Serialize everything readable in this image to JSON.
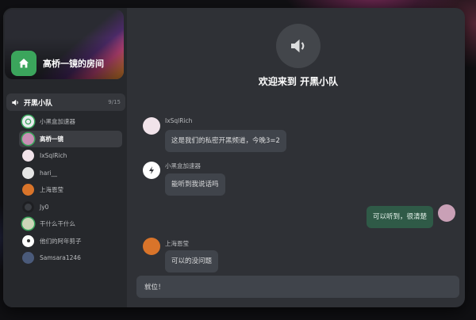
{
  "sidebar": {
    "room_name": "高桥一镜的房间",
    "channel": {
      "name": "开黑小队",
      "count": "9/15"
    },
    "members": [
      {
        "name": "小黑盒加速器",
        "avatar_color": "#e9ecef",
        "avatar_text": "◎"
      },
      {
        "name": "高桥一镜",
        "avatar_color": "#c98fb5",
        "avatar_text": ""
      },
      {
        "name": "IxSqlRich",
        "avatar_color": "#f1e3ea",
        "avatar_text": ""
      },
      {
        "name": "hari__",
        "avatar_color": "#e5e5e5",
        "avatar_text": ""
      },
      {
        "name": "上海恩莹",
        "avatar_color": "#d9742a",
        "avatar_text": ""
      },
      {
        "name": "Jy0",
        "avatar_color": "#3a3d42",
        "avatar_text": ""
      },
      {
        "name": "干什么干什么",
        "avatar_color": "#ccd6b8",
        "avatar_text": ""
      },
      {
        "name": "他们的阿年剪子",
        "avatar_color": "#ffffff",
        "avatar_text": ""
      },
      {
        "name": "Samsara1246",
        "avatar_color": "#4a5a7a",
        "avatar_text": ""
      }
    ]
  },
  "main": {
    "welcome": "欢迎来到 开黑小队",
    "messages": [
      {
        "author": "IxSqlRich",
        "text": "这是我们的私密开黑频道，今晚3=2",
        "avatar_color": "#f1e3ea"
      },
      {
        "author": "小黑盒加速器",
        "text": "能听到我说话吗",
        "avatar_color": "#ffffff"
      },
      {
        "author": "",
        "text": "可以听到，很清楚",
        "avatar_color": "#c9a0b6"
      },
      {
        "author": "上海恩莹",
        "text": "可以的没问题",
        "avatar_color": "#d9742a"
      }
    ]
  },
  "input": {
    "value": "就位！"
  },
  "colors": {
    "accent": "#3ba55c",
    "mine_bubble": "#2f5a47",
    "bubble": "#40444b"
  }
}
